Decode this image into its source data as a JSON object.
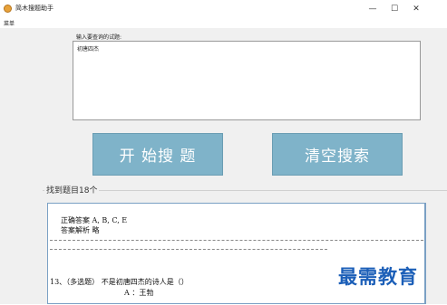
{
  "window": {
    "title": "简木搜题助手",
    "minimize": "—",
    "maximize": "☐",
    "close": "✕"
  },
  "menu": {
    "item": "菜单"
  },
  "query": {
    "label": "输入要查询的试题:",
    "value": "初唐四杰"
  },
  "buttons": {
    "start": "开 始搜 题",
    "clear": "清空搜索"
  },
  "results": {
    "group_title": "找到题目18个",
    "lines": {
      "answer": "正确答案 A, B, C, E",
      "analysis": "答案解析  略",
      "question": "13、（多选题）    不是初唐四杰的诗人是（）",
      "option_a": "A ：王勃"
    }
  },
  "watermark": "最需教育",
  "colors": {
    "button": "#7fb3c9",
    "watermark": "#1c5fb8",
    "results_border": "#7aa0c4"
  }
}
